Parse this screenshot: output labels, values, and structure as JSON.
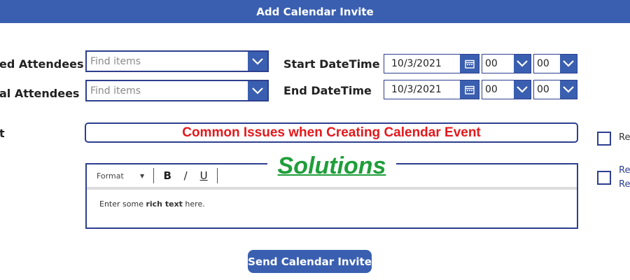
{
  "header": {
    "title": "Add Calendar Invite"
  },
  "form": {
    "required_attendees": {
      "label": "ed Attendees",
      "placeholder": "Find items"
    },
    "optional_attendees": {
      "label": "al Attendees",
      "placeholder": "Find items"
    },
    "start": {
      "label": "Start DateTime",
      "date": "10/3/2021",
      "hour": "00",
      "minute": "00"
    },
    "end": {
      "label": "End DateTime",
      "date": "10/3/2021",
      "hour": "00",
      "minute": "00"
    },
    "subject": {
      "label": "t",
      "value": "Common Issues when Creating Calendar Event"
    }
  },
  "editor": {
    "toolbar": {
      "format": "Format",
      "bold": "B",
      "italic": "/",
      "underline": "U"
    },
    "body": {
      "before": "Enter some ",
      "bold": "rich text",
      "after": " here."
    }
  },
  "overlay_text": "Solutions",
  "checkboxes": [
    {
      "label": "Re"
    },
    {
      "label": "Re",
      "label2": "Re"
    }
  ],
  "send_button": "Send Calendar Invite",
  "colors": {
    "accent": "#3a5fb0",
    "border": "#2e3f8f",
    "subject_text": "#e3191c",
    "overlay_text": "#1f9e3a"
  }
}
